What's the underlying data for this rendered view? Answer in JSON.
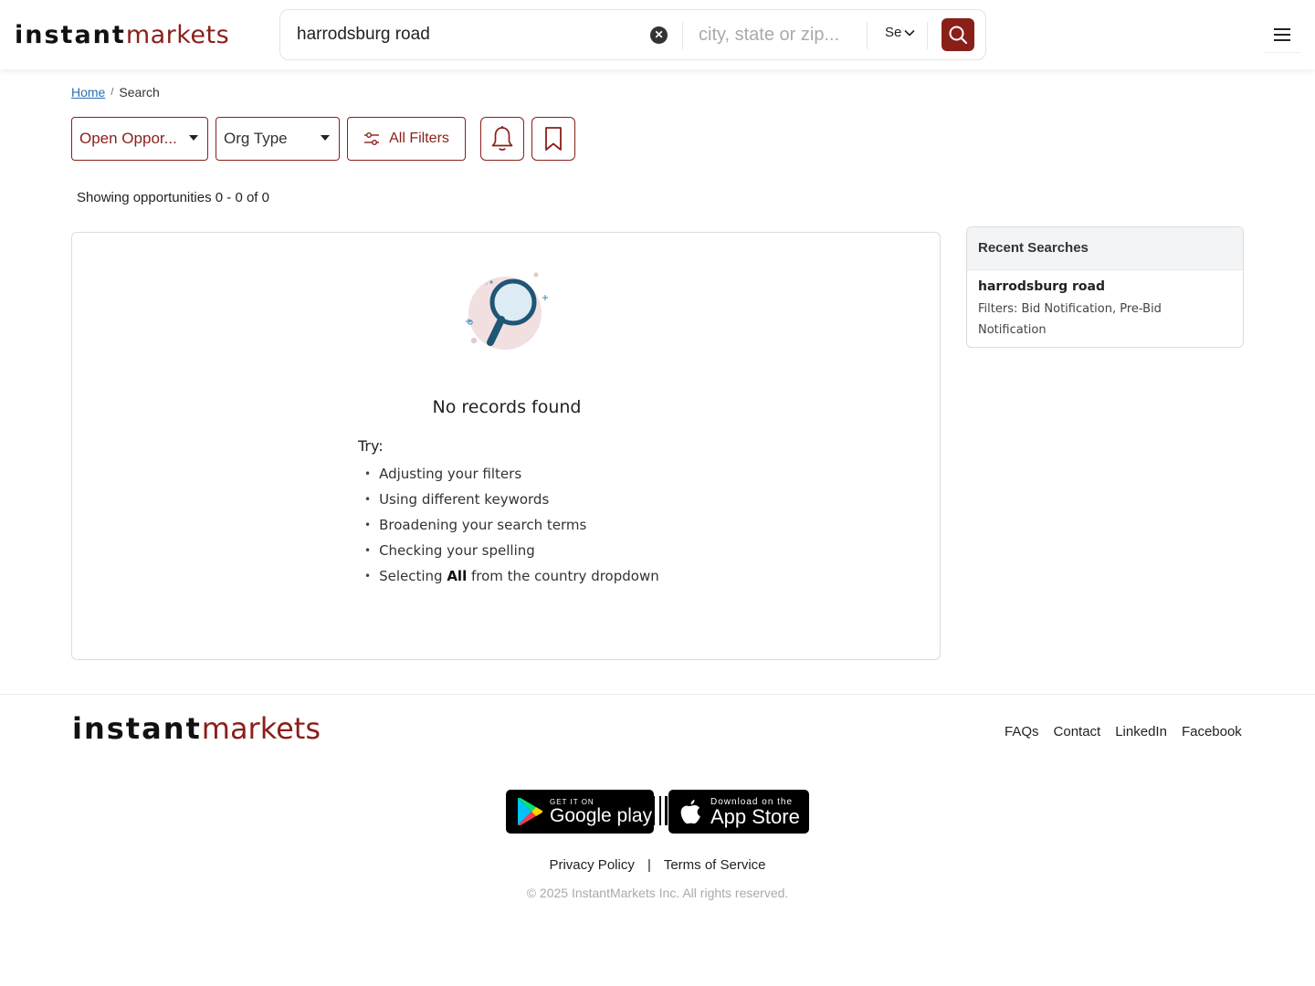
{
  "header": {
    "logo_part1": "instant",
    "logo_part2": "markets",
    "search_value": "harrodsburg road",
    "clear_symbol": "✕",
    "location_placeholder": "city, state or zip...",
    "country_value": "Se",
    "icons": {
      "clear": "close-icon",
      "search": "search-icon",
      "menu": "hamburger-menu-icon",
      "country": "chevron-down-icon"
    },
    "accent_color": "#8a1f1a"
  },
  "breadcrumb": {
    "home": "Home",
    "separator": "/",
    "current": "Search"
  },
  "filters": {
    "status_label": "Open Oppor...",
    "org_type_label": "Org Type",
    "all_filters_label": "All Filters",
    "icons": {
      "all_filters": "sliders-icon",
      "alert": "bell-icon",
      "save": "bookmark-icon",
      "dropdown": "caret-down-icon"
    }
  },
  "results": {
    "showing_text": "Showing opportunities 0 - 0 of 0",
    "empty_title": "No records found",
    "try_label": "Try:",
    "tips": [
      "Adjusting your filters",
      "Using different keywords",
      "Broadening your search terms",
      "Checking your spelling"
    ],
    "tip_last_prefix": "Selecting ",
    "tip_last_bold": "All",
    "tip_last_suffix": " from the country dropdown",
    "illustration_icon": "magnifier-illustration-icon"
  },
  "recent_searches": {
    "title": "Recent Searches",
    "items": [
      {
        "query": "harrodsburg road",
        "filters": "Filters: Bid Notification, Pre-Bid Notification"
      }
    ]
  },
  "footer": {
    "logo_part1": "instant",
    "logo_part2": "markets",
    "links": [
      "FAQs",
      "Contact",
      "LinkedIn",
      "Facebook"
    ],
    "google_play_small": "GET IT ON",
    "google_play_big": "Google play",
    "app_store_small": "Download on the",
    "app_store_big": "App Store",
    "privacy": "Privacy Policy",
    "legal_separator": "|",
    "terms": "Terms of Service",
    "copyright": "© 2025 InstantMarkets Inc. All rights reserved."
  }
}
